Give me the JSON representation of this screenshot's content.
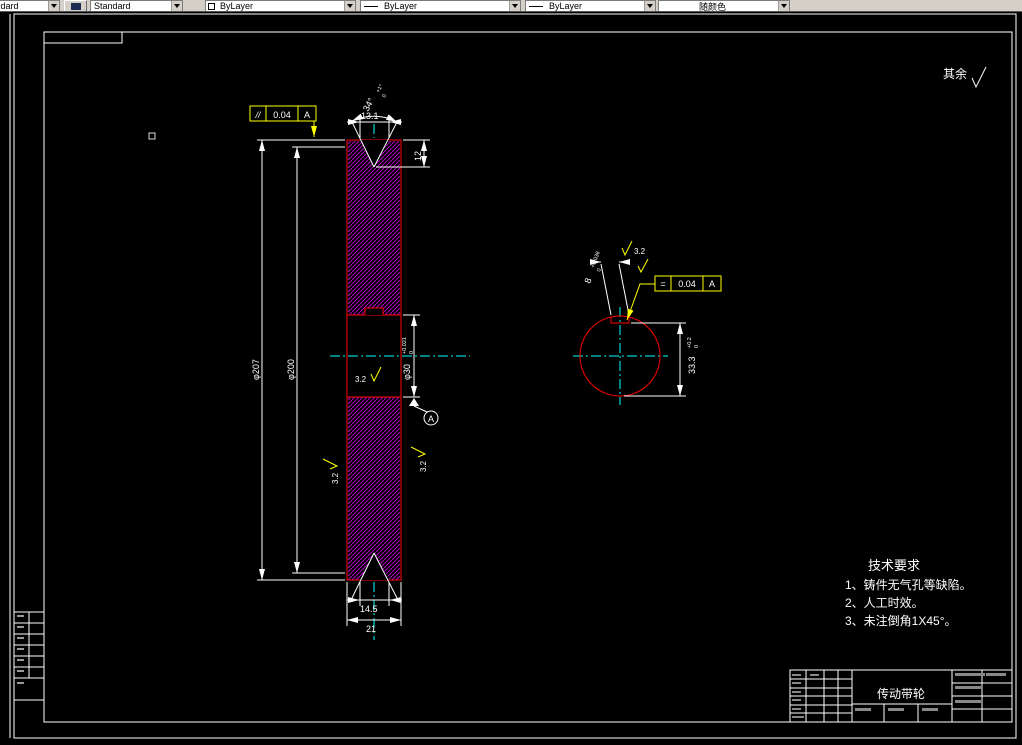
{
  "toolbar": {
    "combos": [
      {
        "value": "Standard"
      },
      {
        "value": "Standard"
      },
      {
        "value": "ByLayer"
      },
      {
        "value": "ByLayer"
      },
      {
        "value": "ByLayer"
      },
      {
        "value": "随颜色"
      }
    ]
  },
  "annotations": {
    "corner_note": "其余",
    "tech_requirements": {
      "title": "技术要求",
      "items": [
        "1、铸件无气孔等缺陷。",
        "2、人工时效。",
        "3、未注倒角1X45°。"
      ]
    }
  },
  "front_view": {
    "outer_diameter": "φ207",
    "pitch_diameter": "φ200",
    "groove_angle": "34°",
    "groove_angle_tol_upper": "+1°",
    "groove_angle_tol_lower": "0",
    "groove_top_width": "13.1",
    "groove_depth": "12",
    "groove_bottom_width": "14.5",
    "rim_width": "21",
    "bore_diameter": "φ30",
    "bore_tol_upper": "+0.021",
    "bore_tol_lower": "0",
    "roughness": "3.2",
    "datum": "A",
    "tolerance": {
      "symbol": "//",
      "value": "0.04",
      "datum": "A"
    }
  },
  "side_view": {
    "keyway_height": "33.3",
    "keyway_height_tol_upper": "+0.2",
    "keyway_height_tol_lower": "0",
    "keyway_width": "8",
    "keyway_width_tol_upper": "+0.036",
    "keyway_width_tol_lower": "0",
    "roughness": "3.2",
    "tolerance": {
      "symbol": "=",
      "value": "0.04",
      "datum": "A"
    }
  },
  "title_block": {
    "part_name": "传动带轮"
  },
  "colors": {
    "outline": "#ff0000",
    "hatch": "#b400c8",
    "dimension": "#ffffff",
    "centerline": "#00ffff",
    "annotation": "#ffff00"
  }
}
